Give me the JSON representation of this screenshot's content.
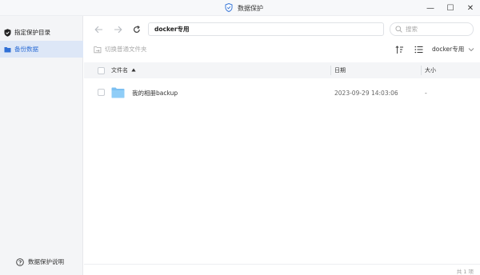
{
  "window": {
    "title": "数据保护",
    "controls": {
      "minimize": "—",
      "maximize": "☐",
      "close": "✕"
    }
  },
  "sidebar": {
    "items": [
      {
        "label": "指定保护目录",
        "icon": "shield-check-icon",
        "active": false
      },
      {
        "label": "备份数据",
        "icon": "folder-icon",
        "active": true
      }
    ],
    "help_label": "数据保护说明"
  },
  "toolbar": {
    "path_value": "docker专用",
    "search_placeholder": "搜索",
    "switch_label": "切换普通文件夹",
    "drive_label": "docker专用"
  },
  "table": {
    "columns": {
      "name": "文件名",
      "date": "日期",
      "size": "大小"
    },
    "sort": {
      "column": "name",
      "direction": "ascending"
    },
    "rows": [
      {
        "name": "我的相册backup",
        "date": "2023-09-29 14:03:06",
        "size": "-",
        "icon": "folder-icon"
      }
    ]
  },
  "footer": {
    "count": "共 1 项"
  },
  "colors": {
    "accent": "#2f6fd6",
    "folder": "#7cc0f2",
    "sidebar_bg": "#f4f5f7",
    "active_bg": "#dde7f7"
  }
}
